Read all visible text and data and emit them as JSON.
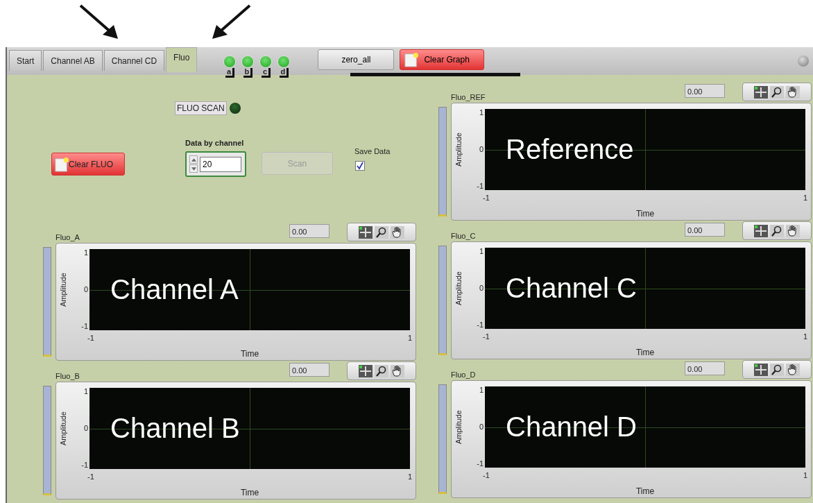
{
  "annotations": [
    {
      "kind": "arrow_down_right"
    },
    {
      "kind": "arrow_down_left"
    }
  ],
  "tabs": [
    {
      "label": "Start",
      "selected": false
    },
    {
      "label": "Channel AB",
      "selected": false
    },
    {
      "label": "Channel CD",
      "selected": false
    },
    {
      "label": "Fluo",
      "selected": true
    }
  ],
  "leds": [
    {
      "label": "a",
      "on": true
    },
    {
      "label": "b",
      "on": true
    },
    {
      "label": "c",
      "on": true
    },
    {
      "label": "d",
      "on": true
    }
  ],
  "toolbar_buttons": [
    {
      "label": "zero_all",
      "kind": "plain"
    },
    {
      "label": "Clear Graph",
      "kind": "alert"
    }
  ],
  "status_led": {
    "on": false
  },
  "fluo_scan": {
    "label": "FLUO SCAN",
    "on": false
  },
  "clear_fluo": {
    "label": "Clear FLUO"
  },
  "data_by_channel": {
    "label": "Data by channel",
    "value": "20"
  },
  "scan_button": {
    "label": "Scan",
    "disabled": true
  },
  "save_data": {
    "label": "Save Data",
    "checked": true
  },
  "left_graphs": [
    {
      "name": "Fluo_A",
      "value": "0.00",
      "ylabel": "Amplitude",
      "xlabel": "Time",
      "y_ticks": [
        "1",
        "0",
        "-1"
      ],
      "x_ticks": [
        "-1",
        "1"
      ],
      "overlay": "Channel A"
    },
    {
      "name": "Fluo_B",
      "value": "0.00",
      "ylabel": "Amplitude",
      "xlabel": "Time",
      "y_ticks": [
        "1",
        "0",
        "-1"
      ],
      "x_ticks": [
        "-1",
        "1"
      ],
      "overlay": "Channel B"
    }
  ],
  "right_graphs": [
    {
      "name": "Fluo_REF",
      "value": "0.00",
      "ylabel": "Amplitude",
      "xlabel": "Time",
      "y_ticks": [
        "1",
        "0",
        "-1"
      ],
      "x_ticks": [
        "-1",
        "1"
      ],
      "overlay": "Reference"
    },
    {
      "name": "Fluo_C",
      "value": "0.00",
      "ylabel": "Amplitude",
      "xlabel": "Time",
      "y_ticks": [
        "1",
        "0",
        "-1"
      ],
      "x_ticks": [
        "-1",
        "1"
      ],
      "overlay": "Channel C"
    },
    {
      "name": "Fluo_D",
      "value": "0.00",
      "ylabel": "Amplitude",
      "xlabel": "Time",
      "y_ticks": [
        "1",
        "0",
        "-1"
      ],
      "x_ticks": [
        "-1",
        "1"
      ],
      "overlay": "Channel D"
    }
  ]
}
